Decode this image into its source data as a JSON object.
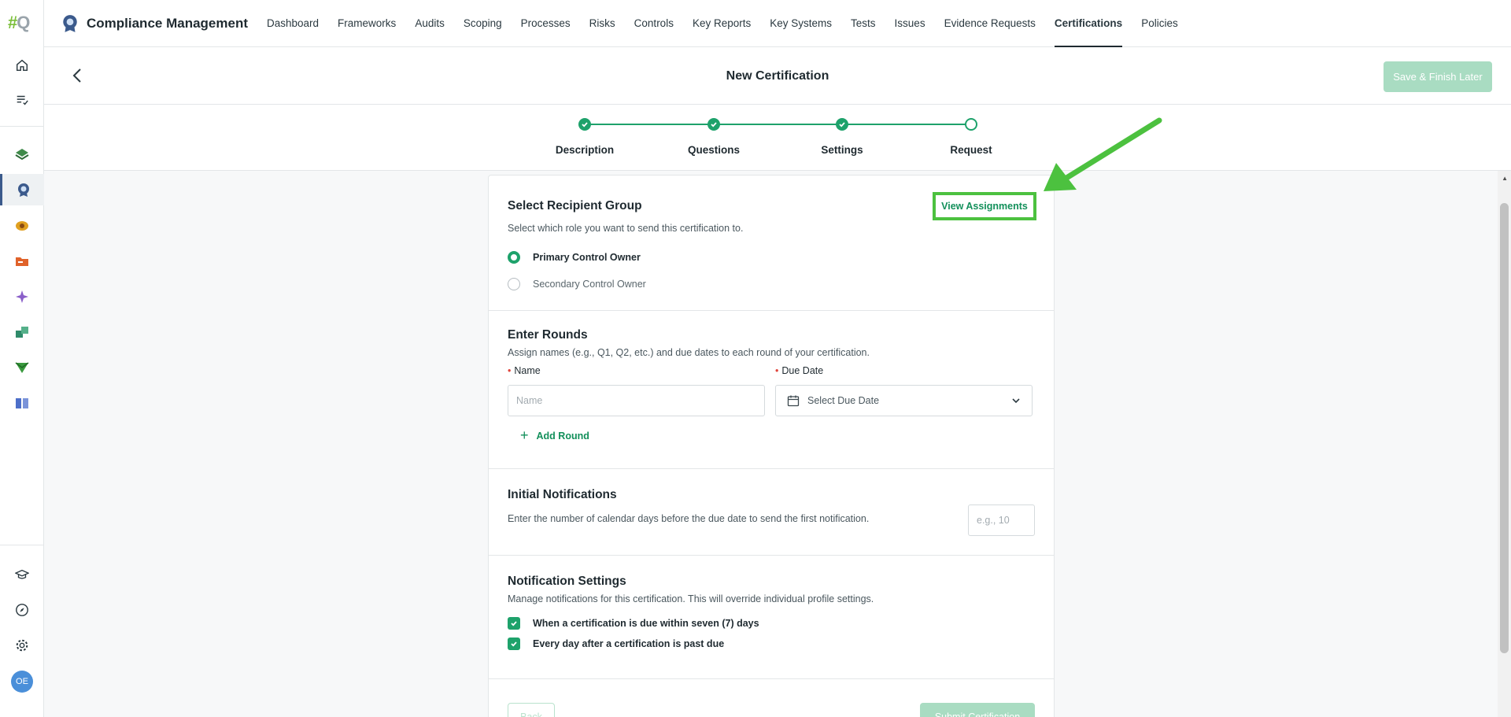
{
  "app": {
    "logo_text_hash": "#",
    "logo_text_q": "Q",
    "title": "Compliance Management",
    "avatar_initials": "OE"
  },
  "nav": {
    "items": [
      {
        "label": "Dashboard"
      },
      {
        "label": "Frameworks"
      },
      {
        "label": "Audits"
      },
      {
        "label": "Scoping"
      },
      {
        "label": "Processes"
      },
      {
        "label": "Risks"
      },
      {
        "label": "Controls"
      },
      {
        "label": "Key Reports"
      },
      {
        "label": "Key Systems"
      },
      {
        "label": "Tests"
      },
      {
        "label": "Issues"
      },
      {
        "label": "Evidence Requests"
      },
      {
        "label": "Certifications"
      },
      {
        "label": "Policies"
      }
    ],
    "active": "Certifications"
  },
  "rail": {
    "icons": [
      "home-icon",
      "tasks-icon",
      "layers-icon",
      "certification-shield-icon",
      "risk-coin-icon",
      "folder-icon",
      "sparkle-icon",
      "stack-icon",
      "send-icon",
      "book-icon",
      "graduation-cap-icon",
      "compass-icon",
      "gear-icon"
    ]
  },
  "header": {
    "title": "New Certification",
    "save_label": "Save & Finish Later"
  },
  "stepper": {
    "steps": [
      {
        "label": "Description",
        "state": "done"
      },
      {
        "label": "Questions",
        "state": "done"
      },
      {
        "label": "Settings",
        "state": "done"
      },
      {
        "label": "Request",
        "state": "current"
      }
    ]
  },
  "recipient": {
    "title": "Select Recipient Group",
    "description": "Select which role you want to send this certification to.",
    "view_assignments": "View Assignments",
    "options": [
      {
        "label": "Primary Control Owner",
        "selected": true
      },
      {
        "label": "Secondary Control Owner",
        "selected": false
      }
    ]
  },
  "rounds": {
    "title": "Enter Rounds",
    "description": "Assign names (e.g., Q1, Q2, etc.) and due dates to each round of your certification.",
    "name_label": "Name",
    "name_placeholder": "Name",
    "due_label": "Due Date",
    "due_placeholder": "Select Due Date",
    "add_round": "Add Round"
  },
  "initial": {
    "title": "Initial Notifications",
    "description": "Enter the number of calendar days before the due date to send the first notification.",
    "placeholder": "e.g., 10"
  },
  "notify": {
    "title": "Notification Settings",
    "description": "Manage notifications for this certification. This will override individual profile settings.",
    "options": [
      {
        "label": "When a certification is due within seven (7) days",
        "checked": true
      },
      {
        "label": "Every day after a certification is past due",
        "checked": true
      }
    ]
  },
  "footer": {
    "back": "Back",
    "submit": "Submit Certification"
  },
  "colors": {
    "accent": "#1ea26b",
    "annotation": "#4cc13f"
  }
}
